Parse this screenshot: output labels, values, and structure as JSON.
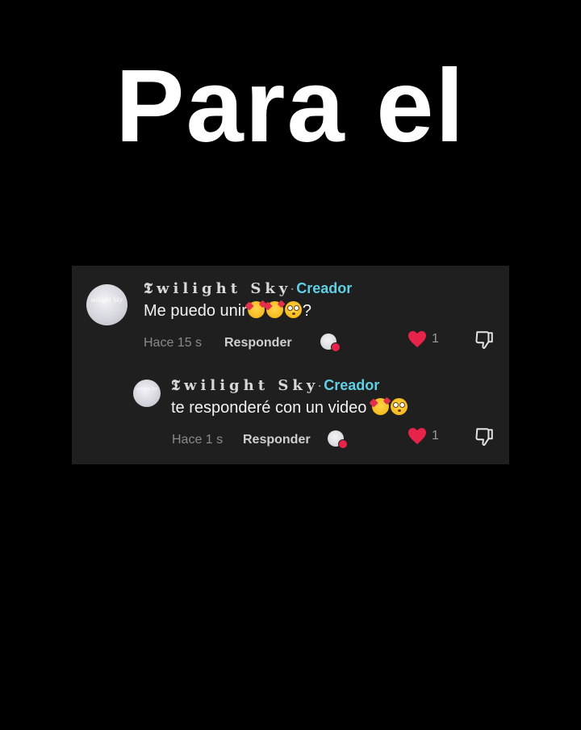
{
  "headline": "Para el",
  "comments": [
    {
      "username": "𝕿wilight Sky",
      "separator": "·",
      "badge": "Creador",
      "text": "Me puedo unir",
      "text_suffix": "?",
      "time": "Hace 15 s",
      "reply_label": "Responder",
      "like_count": "1",
      "avatar_watermark": "wilight Sky"
    },
    {
      "username": "𝕿wilight Sky",
      "separator": "·",
      "badge": "Creador",
      "text": "te responderé con un video",
      "text_suffix": "",
      "time": "Hace 1 s",
      "reply_label": "Responder",
      "like_count": "1",
      "avatar_watermark": "wilight Sky"
    }
  ],
  "colors": {
    "background": "#000000",
    "panel": "#1f1f1f",
    "creator_badge": "#5fd0e4",
    "like_heart": "#e8234a"
  },
  "icons": {
    "like": "heart-icon",
    "dislike": "thumbs-down-icon",
    "emoji_1": "smiling-face-with-hearts-emoji",
    "emoji_2": "flushed-face-emoji"
  }
}
